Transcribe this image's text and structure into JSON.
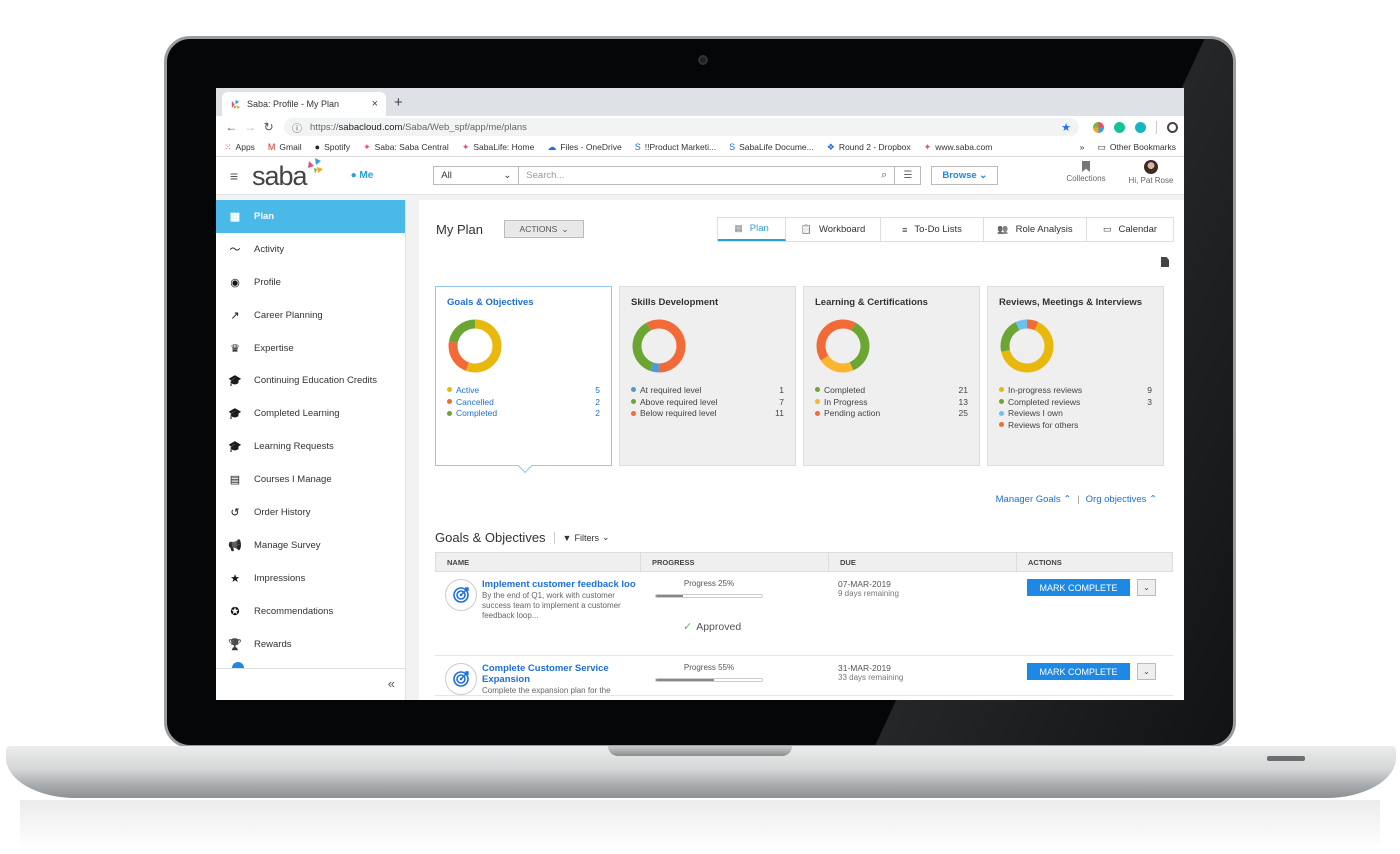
{
  "browser": {
    "tab_title": "Saba: Profile - My Plan",
    "url_prefix": "https://",
    "url_domain": "sabacloud.com",
    "url_path": "/Saba/Web_spf/app/me/plans",
    "bookmarks": [
      {
        "label": "Apps",
        "icon": "apps-grid-icon"
      },
      {
        "label": "Gmail",
        "icon": "gmail-icon"
      },
      {
        "label": "Spotify",
        "icon": "spotify-icon"
      },
      {
        "label": "Saba: Saba Central",
        "icon": "saba-icon"
      },
      {
        "label": "SabaLife: Home",
        "icon": "saba-icon"
      },
      {
        "label": "Files - OneDrive",
        "icon": "onedrive-icon"
      },
      {
        "label": "!!Product Marketi...",
        "icon": "sharepoint-icon"
      },
      {
        "label": "SabaLife Docume...",
        "icon": "sharepoint-icon"
      },
      {
        "label": "Round 2 - Dropbox",
        "icon": "dropbox-icon"
      },
      {
        "label": "www.saba.com",
        "icon": "saba-icon"
      }
    ],
    "more_bookmarks": "»",
    "other_bookmarks": "Other Bookmarks"
  },
  "header": {
    "logo": "saba",
    "me_label": "Me",
    "scope_value": "All",
    "search_placeholder": "Search...",
    "browse_label": "Browse",
    "collections_label": "Collections",
    "user_greeting": "Hi, Pat Rose"
  },
  "sidebar": {
    "items": [
      {
        "label": "Plan",
        "icon": "dashboard-icon",
        "active": true
      },
      {
        "label": "Activity",
        "icon": "activity-icon"
      },
      {
        "label": "Profile",
        "icon": "profile-icon"
      },
      {
        "label": "Career Planning",
        "icon": "trending-up-icon"
      },
      {
        "label": "Expertise",
        "icon": "crown-icon"
      },
      {
        "label": "Continuing Education Credits",
        "icon": "graduation-cap-icon"
      },
      {
        "label": "Completed Learning",
        "icon": "graduation-cap-check-icon"
      },
      {
        "label": "Learning Requests",
        "icon": "graduation-cap-clock-icon"
      },
      {
        "label": "Courses I Manage",
        "icon": "book-icon"
      },
      {
        "label": "Order History",
        "icon": "history-icon"
      },
      {
        "label": "Manage Survey",
        "icon": "megaphone-icon"
      },
      {
        "label": "Impressions",
        "icon": "star-icon"
      },
      {
        "label": "Recommendations",
        "icon": "award-icon"
      },
      {
        "label": "Rewards",
        "icon": "trophy-icon"
      }
    ],
    "collapse_label": "«"
  },
  "main": {
    "title": "My Plan",
    "actions_label": "ACTIONS",
    "tabs": [
      {
        "label": "Plan",
        "icon": "dashboard-icon",
        "active": true
      },
      {
        "label": "Workboard",
        "icon": "clipboard-icon"
      },
      {
        "label": "To-Do Lists",
        "icon": "list-icon"
      },
      {
        "label": "Role Analysis",
        "icon": "people-icon"
      },
      {
        "label": "Calendar",
        "icon": "calendar-icon"
      }
    ],
    "cards": [
      {
        "title": "Goals & Objectives",
        "selected": true,
        "legend": [
          {
            "label": "Active",
            "value": 5,
            "color": "#e8b80c"
          },
          {
            "label": "Cancelled",
            "value": 2,
            "color": "#f26a37"
          },
          {
            "label": "Completed",
            "value": 2,
            "color": "#6aa631"
          }
        ]
      },
      {
        "title": "Skills Development",
        "legend": [
          {
            "label": "At required level",
            "value": 1,
            "color": "#4b9bd8"
          },
          {
            "label": "Above required level",
            "value": 7,
            "color": "#6aa631"
          },
          {
            "label": "Below required level",
            "value": 11,
            "color": "#f26a37"
          }
        ]
      },
      {
        "title": "Learning & Certifications",
        "legend": [
          {
            "label": "Completed",
            "value": 21,
            "color": "#6aa631"
          },
          {
            "label": "In Progress",
            "value": 13,
            "color": "#fbb52f"
          },
          {
            "label": "Pending action",
            "value": 25,
            "color": "#f26a37"
          }
        ]
      },
      {
        "title": "Reviews, Meetings & Interviews",
        "legend": [
          {
            "label": "In-progress reviews",
            "value": 9,
            "color": "#e8b80c"
          },
          {
            "label": "Completed reviews",
            "value": 3,
            "color": "#6aa631"
          },
          {
            "label": "Reviews I own",
            "value": null,
            "color": "#6cc1f0"
          },
          {
            "label": "Reviews for others",
            "value": null,
            "color": "#f26a37"
          }
        ]
      }
    ],
    "manager_goals_label": "Manager Goals",
    "org_objectives_label": "Org objectives",
    "goals_title": "Goals & Objectives",
    "filters_label": "Filters",
    "columns": [
      "NAME",
      "PROGRESS",
      "DUE",
      "ACTIONS"
    ],
    "goals": [
      {
        "name": "Implement customer feedback loo",
        "description": "By the end of Q1, work with customer success team to implement a customer feedback loop...",
        "progress_label": "Progress 25%",
        "progress": 25,
        "status": "Approved",
        "due": "07-MAR-2019",
        "remaining": "9 days remaining",
        "action": "MARK COMPLETE"
      },
      {
        "name": "Complete Customer Service Expansion",
        "description": "Complete the expansion plan for the",
        "progress_label": "Progress 55%",
        "progress": 55,
        "status": "",
        "due": "31-MAR-2019",
        "remaining": "33 days remaining",
        "action": "MARK COMPLETE"
      }
    ]
  },
  "chart_data": [
    {
      "type": "pie",
      "title": "Goals & Objectives",
      "categories": [
        "Active",
        "Cancelled",
        "Completed"
      ],
      "values": [
        5,
        2,
        2
      ]
    },
    {
      "type": "pie",
      "title": "Skills Development",
      "categories": [
        "At required level",
        "Above required level",
        "Below required level"
      ],
      "values": [
        1,
        7,
        11
      ]
    },
    {
      "type": "pie",
      "title": "Learning & Certifications",
      "categories": [
        "Completed",
        "In Progress",
        "Pending action"
      ],
      "values": [
        21,
        13,
        25
      ]
    },
    {
      "type": "pie",
      "title": "Reviews, Meetings & Interviews",
      "categories": [
        "In-progress reviews",
        "Completed reviews",
        "Reviews I own",
        "Reviews for others"
      ],
      "values": [
        9,
        3,
        1,
        1
      ]
    }
  ]
}
